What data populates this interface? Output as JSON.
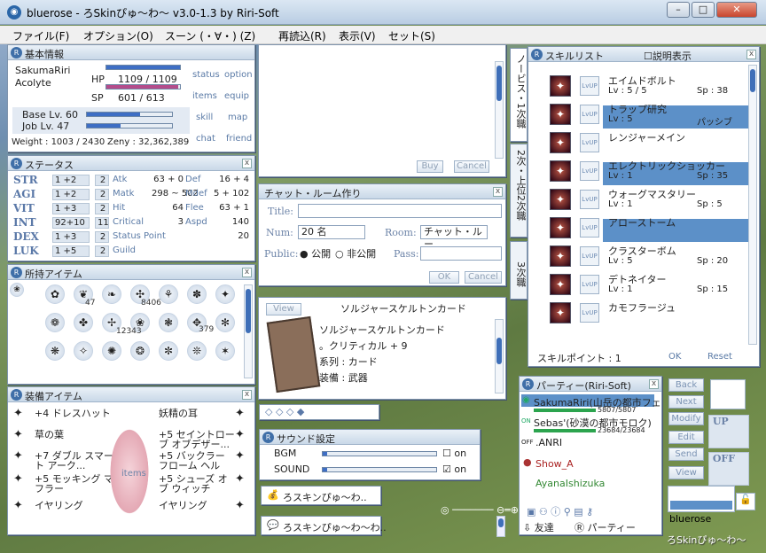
{
  "window": {
    "title": "bluerose - ろSkinぴゅ～わ～ v3.0-1.3 by Riri-Soft"
  },
  "menu": [
    "ファイル(F)",
    "オプション(O)",
    "スーン (・∀・) (Z)",
    "再読込(R)",
    "表示(V)",
    "セット(S)"
  ],
  "basic": {
    "title": "基本情報",
    "name": "SakumaRiri",
    "job": "Acolyte",
    "hp_label": "HP",
    "hp": "1109 / 1109",
    "sp_label": "SP",
    "sp": "601 / 613",
    "base_lv": "Base Lv. 60",
    "job_lv": "Job Lv. 47",
    "weight": "Weight : 1003 / 2430",
    "zeny": "Zeny : 32,362,389",
    "links": [
      "status",
      "option",
      "items",
      "equip",
      "skill",
      "map",
      "chat",
      "friend"
    ]
  },
  "status": {
    "title": "ステータス",
    "stats": [
      {
        "name": "STR",
        "val": "1 +2",
        "pts": "2",
        "k": "Atk",
        "v": "63 + 0",
        "k2": "Def",
        "v2": "16 + 4"
      },
      {
        "name": "AGI",
        "val": "1 +2",
        "pts": "2",
        "k": "Matk",
        "v": "298 ~ 502",
        "k2": "Mdef",
        "v2": "5 + 102"
      },
      {
        "name": "VIT",
        "val": "1 +3",
        "pts": "2",
        "k": "Hit",
        "v": "64",
        "k2": "Flee",
        "v2": "63 + 1"
      },
      {
        "name": "INT",
        "val": "92+10",
        "pts": "11",
        "k": "Critical",
        "v": "3",
        "k2": "Aspd",
        "v2": "140"
      },
      {
        "name": "DEX",
        "val": "1 +3",
        "pts": "2",
        "k": "Status Point",
        "v": "",
        "k2": "",
        "v2": "20"
      },
      {
        "name": "LUK",
        "val": "1 +5",
        "pts": "2",
        "k": "Guild",
        "v": "",
        "k2": "",
        "v2": ""
      }
    ]
  },
  "inventory": {
    "title": "所持アイテム",
    "qty": [
      "47",
      "8406",
      "379",
      "12343"
    ]
  },
  "equip": {
    "title": "装備アイテム",
    "left": [
      "+4 ドレスハット",
      "草の葉",
      "+7 ダブル スマート アーク...",
      "+5 モッキング マフラー",
      "イヤリング"
    ],
    "right": [
      "妖精の耳",
      "+5 セイントローブ オブデザー...",
      "+5 バックラー フローム ヘル",
      "+5 シューズ オブ ウィッチ",
      "イヤリング"
    ],
    "center_label": "items"
  },
  "shop": {
    "buy": "Buy",
    "cancel": "Cancel"
  },
  "chatroom": {
    "title": "チャット・ルーム作り",
    "title_label": "Title:",
    "num_label": "Num:",
    "num": "20 名",
    "room_label": "Room:",
    "room": "チャット・ルー",
    "public_label": "Public:",
    "public": "公開",
    "private": "非公開",
    "pass_label": "Pass:",
    "ok": "OK",
    "cancel": "Cancel"
  },
  "card": {
    "view": "View",
    "name": "ソルジャースケルトンカード",
    "desc": [
      "ソルジャースケルトンカード",
      "。クリティカル + 9",
      "系列 : カード",
      "装備 : 武器"
    ],
    "desc_gray": [
      "",
      "",
      "カード",
      "武器"
    ]
  },
  "sound": {
    "title": "サウンド設定",
    "bgm": "BGM",
    "sound": "SOUND",
    "on": "on"
  },
  "tasks": [
    "ろスキンぴゅ～わ..",
    "ろスキンぴゅ～わ～わ.."
  ],
  "tabs": [
    "ノービス・1次職",
    "2次・上位2次職",
    "3次職"
  ],
  "skills": {
    "title": "スキルリスト",
    "desc_label": "説明表示",
    "points": "スキルポイント : 1",
    "ok": "OK",
    "reset": "Reset",
    "list": [
      {
        "name": "エイムドボルト",
        "lv": "Lv : 5 / 5",
        "sp": "Sp : 38",
        "sel": false
      },
      {
        "name": "トラップ研究",
        "lv": "Lv : 5",
        "sp": "パッシブ",
        "sel": true
      },
      {
        "name": "レンジャーメイン",
        "lv": "",
        "sp": "",
        "sel": false
      },
      {
        "name": "エレクトリックショッカー",
        "lv": "Lv : 1",
        "sp": "Sp : 35",
        "sel": true
      },
      {
        "name": "ウォーグマスタリー",
        "lv": "Lv : 1",
        "sp": "Sp : 5",
        "sel": false
      },
      {
        "name": "アローストーム",
        "lv": "",
        "sp": "",
        "sel": true
      },
      {
        "name": "クラスターボム",
        "lv": "Lv : 5",
        "sp": "Sp : 20",
        "sel": false
      },
      {
        "name": "デトネイター",
        "lv": "Lv : 1",
        "sp": "Sp : 15",
        "sel": false
      },
      {
        "name": "カモフラージュ",
        "lv": "",
        "sp": "",
        "sel": false
      }
    ]
  },
  "party": {
    "title": "パーティー(Riri-Soft)",
    "members": [
      {
        "name": "SakumaRiri(山岳の都市フェ",
        "hp": "5807/5807"
      },
      {
        "name": "Sebas'(砂漠の都市モロク)",
        "hp": "23684/23684"
      },
      {
        "name": ".ANRI",
        "hp": ""
      },
      {
        "name": "Show_A",
        "hp": ""
      },
      {
        "name": "AyanaIshizuka",
        "hp": ""
      }
    ],
    "side": [
      "Back",
      "Next",
      "Modify",
      "Edit",
      "Send",
      "View"
    ],
    "friends": "友達",
    "party_tab": "パーティー"
  },
  "bottom": {
    "name": "bluerose",
    "logo": "ろSkinぴゅ～わ～"
  },
  "colors": {
    "accent": "#3e6ec4",
    "select": "#5c90c8",
    "green": "#2ca44e"
  }
}
